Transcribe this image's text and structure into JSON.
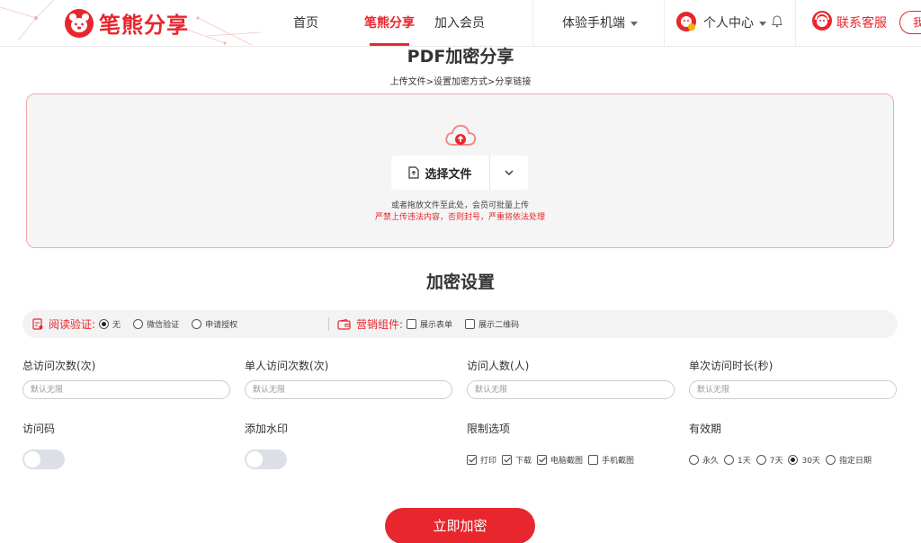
{
  "header": {
    "logo_text": "笔熊分享",
    "nav": [
      "首页",
      "笔熊分享",
      "加入会员",
      "体验手机端"
    ],
    "user_center": "个人中心",
    "service": "联系客服",
    "edge_text": "我"
  },
  "page": {
    "title": "PDF加密分享",
    "steps": "上传文件>设置加密方式>分享链接"
  },
  "upload": {
    "select_label": "选择文件",
    "hint": "或者拖放文件至此处，会员可批量上传",
    "warning": "严禁上传违法内容，否则封号，严重将依法处理"
  },
  "settings": {
    "title": "加密设置",
    "read_verify": {
      "label": "阅读验证:",
      "options": [
        {
          "label": "无",
          "checked": true
        },
        {
          "label": "微信验证",
          "checked": false
        },
        {
          "label": "申请授权",
          "checked": false
        }
      ]
    },
    "marketing": {
      "label": "营销组件:",
      "options": [
        {
          "label": "展示表单",
          "checked": false
        },
        {
          "label": "展示二维码",
          "checked": false
        }
      ]
    },
    "fields": [
      {
        "label": "总访问次数(次)",
        "placeholder": "默认无限"
      },
      {
        "label": "单人访问次数(次)",
        "placeholder": "默认无限"
      },
      {
        "label": "访问人数(人)",
        "placeholder": "默认无限"
      },
      {
        "label": "单次访问时长(秒)",
        "placeholder": "默认无限"
      }
    ],
    "access_code": {
      "label": "访问码",
      "on": false
    },
    "watermark": {
      "label": "添加水印",
      "on": false
    },
    "limits": {
      "label": "限制选项",
      "options": [
        {
          "label": "打印",
          "checked": true
        },
        {
          "label": "下载",
          "checked": true
        },
        {
          "label": "电脑截图",
          "checked": true
        },
        {
          "label": "手机截图",
          "checked": false
        }
      ]
    },
    "validity": {
      "label": "有效期",
      "options": [
        {
          "label": "永久",
          "checked": false
        },
        {
          "label": "1天",
          "checked": false
        },
        {
          "label": "7天",
          "checked": false
        },
        {
          "label": "30天",
          "checked": true
        },
        {
          "label": "指定日期",
          "checked": false
        }
      ]
    },
    "submit": "立即加密"
  },
  "colors": {
    "accent": "#e8262d"
  }
}
